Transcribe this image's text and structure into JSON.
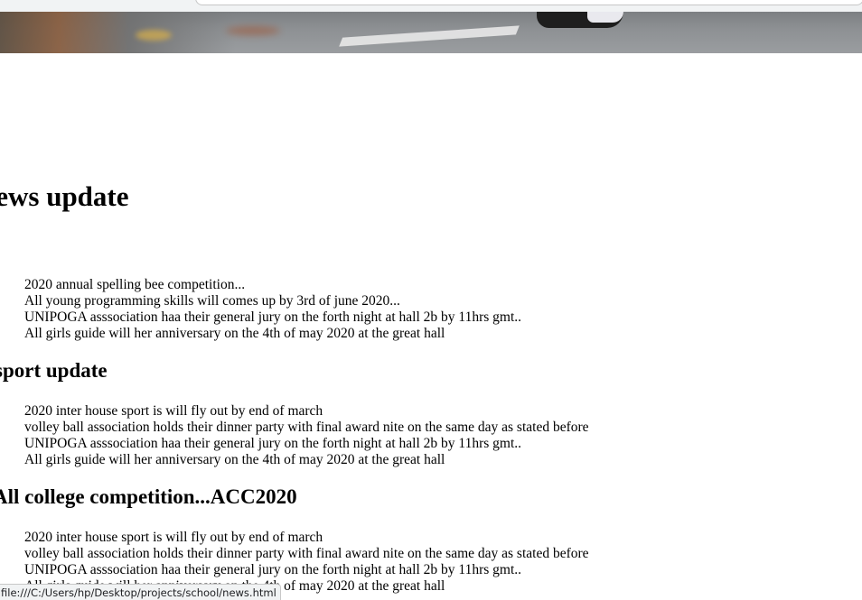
{
  "browser": {
    "status_url": "file:///C:/Users/hp/Desktop/projects/school/news.html"
  },
  "sections": [
    {
      "title": "news update",
      "items": [
        "2020 annual spelling bee competition...",
        "All young programming skills will comes up by 3rd of june 2020...",
        "UNIPOGA asssociation haa their general jury on the forth night at hall 2b by 11hrs gmt..",
        "All girls guide will her anniversary on the 4th of may 2020 at the great hall"
      ]
    },
    {
      "title": "sport update",
      "items": [
        "2020 inter house sport is will fly out by end of march",
        "volley ball association holds their dinner party with final award nite on the same day as stated before",
        "UNIPOGA asssociation haa their general jury on the forth night at hall 2b by 11hrs gmt..",
        "All girls guide will her anniversary on the 4th of may 2020 at the great hall"
      ]
    },
    {
      "title": "All college competition...ACC2020",
      "items": [
        "2020 inter house sport is will fly out by end of march",
        "volley ball association holds their dinner party with final award nite on the same day as stated before",
        "UNIPOGA asssociation haa their general jury on the forth night at hall 2b by 11hrs gmt..",
        "All girls guide will her anniversary on the 4th of may 2020 at the great hall"
      ]
    }
  ]
}
